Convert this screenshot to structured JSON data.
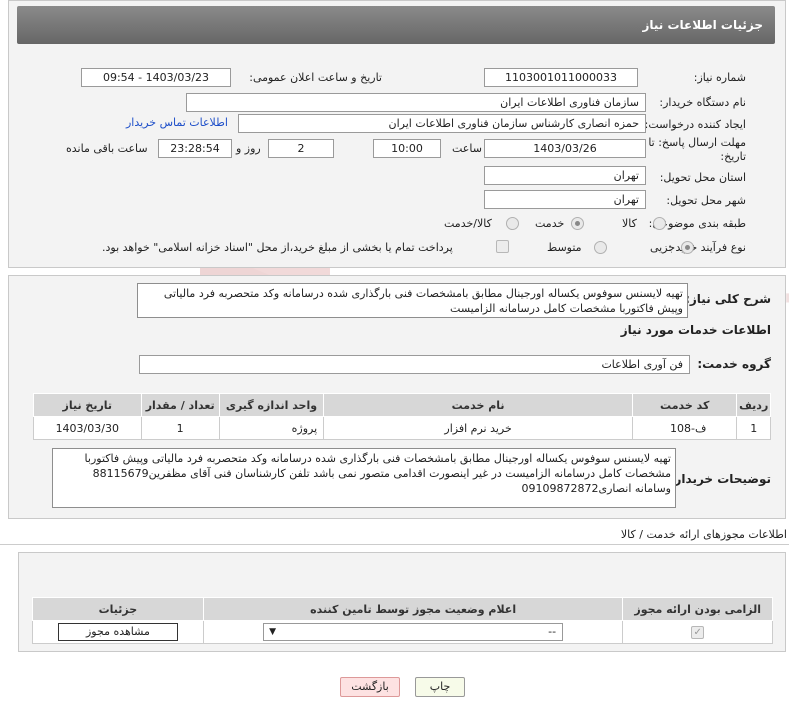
{
  "header": {
    "title": "جزئیات اطلاعات نیاز"
  },
  "form": {
    "need_number_label": "شماره نیاز:",
    "need_number": "1103001011000033",
    "announce_label": "تاریخ و ساعت اعلان عمومی:",
    "announce_value": "1403/03/23 - 09:54",
    "buyer_org_label": "نام دستگاه خریدار:",
    "buyer_org": "سازمان فناوری اطلاعات ایران",
    "creator_label": "ایجاد کننده درخواست:",
    "creator": "حمزه انصاری کارشناس سازمان فناوری اطلاعات ایران",
    "contact_link": "اطلاعات تماس خریدار",
    "deadline_label": "مهلت ارسال پاسخ: تا تاریخ:",
    "deadline_date": "1403/03/26",
    "time_label": "ساعت",
    "deadline_time": "10:00",
    "days_value": "2",
    "days_label": "روز و",
    "remaining_time": "23:28:54",
    "remaining_label": "ساعت باقی مانده",
    "province_label": "استان محل تحویل:",
    "province": "تهران",
    "city_label": "شهر محل تحویل:",
    "city": "تهران",
    "category_label": "طبقه بندی موضوعی:",
    "category_options": [
      "کالا",
      "خدمت",
      "کالا/خدمت"
    ],
    "category_selected": "خدمت",
    "process_label": "نوع فرآیند خرید :",
    "process_options": [
      "جزیی",
      "متوسط"
    ],
    "process_selected": "جزیی",
    "payment_note": "پرداخت تمام یا بخشی از مبلغ خرید،از محل \"اسناد خزانه اسلامی\" خواهد بود."
  },
  "summary": {
    "label": "شرح کلی نیاز:",
    "text": "تهیه لایسنس سوفوس یکساله اورجینال مطابق بامشخصات فنی بارگذاری شده درسامانه وکد متحصربه فرد مالیاتی وپیش فاکتوربا مشخصات کامل درسامانه الزامیست"
  },
  "services": {
    "section_title": "اطلاعات خدمات مورد نیاز",
    "group_label": "گروه خدمت:",
    "group_value": "فن آوری اطلاعات",
    "columns": [
      "ردیف",
      "کد خدمت",
      "نام خدمت",
      "واحد اندازه گیری",
      "تعداد / مقدار",
      "تاریخ نیاز"
    ],
    "rows": [
      {
        "row": "1",
        "code": "ف-108",
        "name": "خرید نرم افزار",
        "unit": "پروژه",
        "qty": "1",
        "date": "1403/03/30"
      }
    ]
  },
  "buyer_notes": {
    "label": "توضیحات خریدار:",
    "text": "تهیه لایسنس سوفوس یکساله اورجینال مطابق بامشخصات فنی بارگذاری شده درسامانه وکد متحصربه فرد مالیاتی وپیش فاکتوربا مشخصات کامل درسامانه الزامیست در غیر اینصورت اقدامی متصور نمی باشد تلفن کارشناسان فنی آقای مظفرین88115679 وسامانه انصاری09109872872"
  },
  "permits": {
    "section_title": "اطلاعات مجوزهای ارائه خدمت / کالا",
    "columns": [
      "الزامی بودن ارائه مجوز",
      "اعلام وضعیت مجوز توسط تامین کننده",
      "جزئیات"
    ],
    "select_value": "--",
    "view_button": "مشاهده مجوز"
  },
  "actions": {
    "print": "چاپ",
    "back": "بازگشت"
  },
  "watermark_text": "AriaTender.neT",
  "colors": {
    "header_bg": "#777777",
    "link": "#1e4fc9",
    "back_btn": "#fde2e2",
    "watermark": "#e8c7c7"
  }
}
